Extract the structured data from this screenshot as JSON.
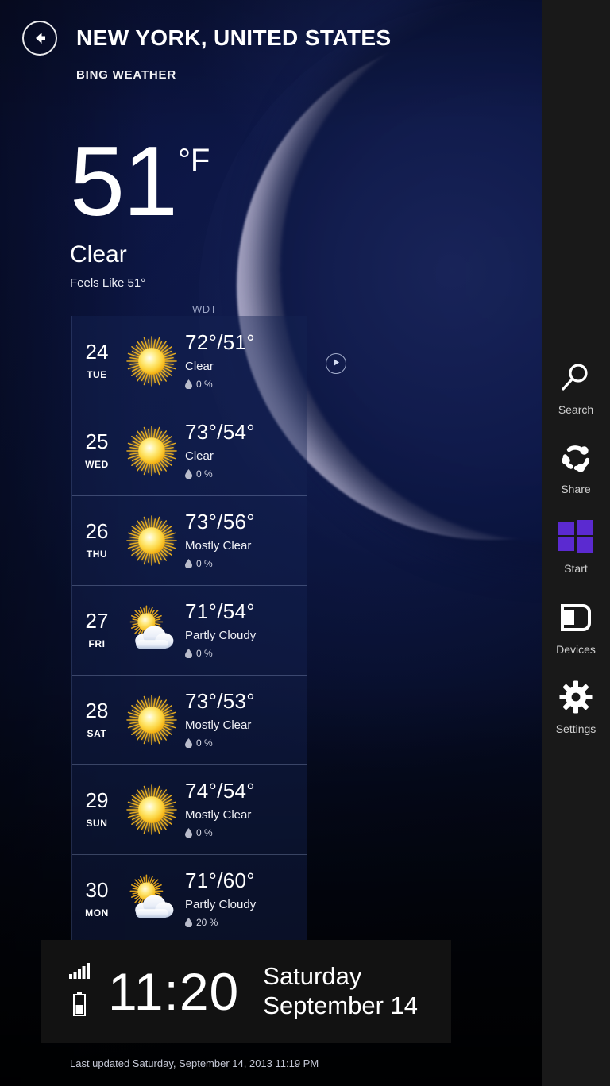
{
  "header": {
    "back_icon": "back-arrow-icon",
    "title": "NEW YORK, UNITED STATES",
    "subtitle": "BING WEATHER"
  },
  "current": {
    "temperature": "51",
    "unit": "°F",
    "condition": "Clear",
    "feels_like": "Feels Like 51°"
  },
  "forecast": {
    "source_label": "WDT",
    "play_icon": "play-icon",
    "days": [
      {
        "day_num": "24",
        "day_name": "TUE",
        "icon": "sunny-icon",
        "temps": "72°/51°",
        "condition": "Clear",
        "precip": "0 %"
      },
      {
        "day_num": "25",
        "day_name": "WED",
        "icon": "sunny-icon",
        "temps": "73°/54°",
        "condition": "Clear",
        "precip": "0 %"
      },
      {
        "day_num": "26",
        "day_name": "THU",
        "icon": "sunny-icon",
        "temps": "73°/56°",
        "condition": "Mostly Clear",
        "precip": "0 %"
      },
      {
        "day_num": "27",
        "day_name": "FRI",
        "icon": "partly-cloudy-icon",
        "temps": "71°/54°",
        "condition": "Partly Cloudy",
        "precip": "0 %"
      },
      {
        "day_num": "28",
        "day_name": "SAT",
        "icon": "sunny-icon",
        "temps": "73°/53°",
        "condition": "Mostly Clear",
        "precip": "0 %"
      },
      {
        "day_num": "29",
        "day_name": "SUN",
        "icon": "sunny-icon",
        "temps": "74°/54°",
        "condition": "Mostly Clear",
        "precip": "0 %"
      },
      {
        "day_num": "30",
        "day_name": "MON",
        "icon": "partly-cloudy-icon",
        "temps": "71°/60°",
        "condition": "Partly Cloudy",
        "precip": "20 %"
      }
    ]
  },
  "clock_overlay": {
    "signal_icon": "signal-bars-icon",
    "battery_icon": "battery-icon",
    "time": "11:20",
    "day_of_week": "Saturday",
    "date": "September 14"
  },
  "footer": {
    "last_updated": "Last updated Saturday, September 14, 2013 11:19 PM"
  },
  "charms": {
    "items": [
      {
        "icon": "search-icon",
        "label": "Search"
      },
      {
        "icon": "share-icon",
        "label": "Share"
      },
      {
        "icon": "windows-icon",
        "label": "Start"
      },
      {
        "icon": "devices-icon",
        "label": "Devices"
      },
      {
        "icon": "settings-icon",
        "label": "Settings"
      }
    ],
    "start_color": "#5b2ad0"
  }
}
